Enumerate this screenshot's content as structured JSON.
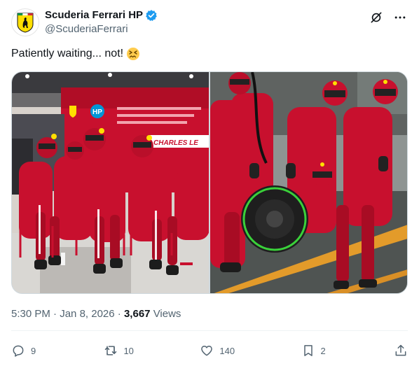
{
  "author": {
    "display_name": "Scuderia Ferrari HP",
    "handle": "@ScuderiaFerrari",
    "verified": true,
    "avatar_icon": "ferrari-prancing-horse-shield-icon",
    "brand_yellow": "#FFDF00"
  },
  "tweet": {
    "text": "Patiently waiting... not!",
    "emoji": "confounded-face-emoji"
  },
  "media": {
    "left_photo": {
      "description_icon": "pit-crew-seated-in-garage-photo",
      "garage_banner": "CHARLES LE",
      "sponsor_logo": "HP"
    },
    "right_photo": {
      "description_icon": "pit-crew-tyre-change-photo"
    }
  },
  "meta": {
    "time": "5:30 PM",
    "separator": "·",
    "date": "Jan 8, 2026",
    "views_count": "3,667",
    "views_label": "Views"
  },
  "actions": {
    "replies": "9",
    "reposts": "10",
    "likes": "140",
    "bookmarks": "2"
  },
  "colors": {
    "text_secondary": "#536471",
    "verified_blue": "#1D9BF0",
    "ferrari_red": "#C8102E"
  }
}
